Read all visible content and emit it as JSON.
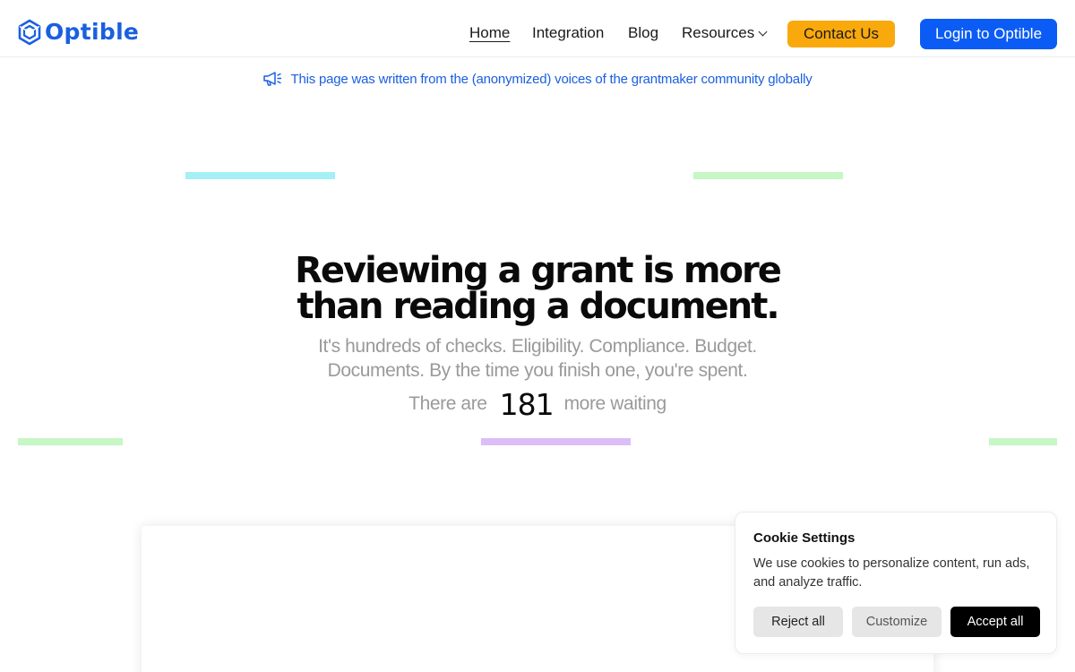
{
  "header": {
    "logo_text": "Optible",
    "nav": [
      {
        "label": "Home",
        "active": true
      },
      {
        "label": "Integration"
      },
      {
        "label": "Blog"
      },
      {
        "label": "Resources",
        "has_dropdown": true
      }
    ],
    "contact_label": "Contact Us",
    "login_label": "Login to Optible"
  },
  "announcement": {
    "icon": "megaphone-icon",
    "text": "This page was written from the (anonymized) voices of the grantmaker community globally"
  },
  "hero": {
    "title": "Reviewing a grant is more than reading a document.",
    "subtitle": "It's hundreds of checks. Eligibility. Compliance. Budget. Documents. By the time you finish one, you're spent.",
    "waiting_prefix": "There are",
    "waiting_count": "181",
    "waiting_suffix": "more waiting"
  },
  "cookie": {
    "title": "Cookie Settings",
    "text": "We use cookies to personalize content, run ads, and analyze traffic.",
    "reject_label": "Reject all",
    "customize_label": "Customize",
    "accept_label": "Accept all"
  },
  "colors": {
    "brand_blue": "#1a5fe0",
    "login_blue": "#0b5cf5",
    "contact_orange": "#f9a90c",
    "bar_cyan": "#a5f0f7",
    "bar_green": "#c6f7c4",
    "bar_purple": "#dcbdf6"
  }
}
